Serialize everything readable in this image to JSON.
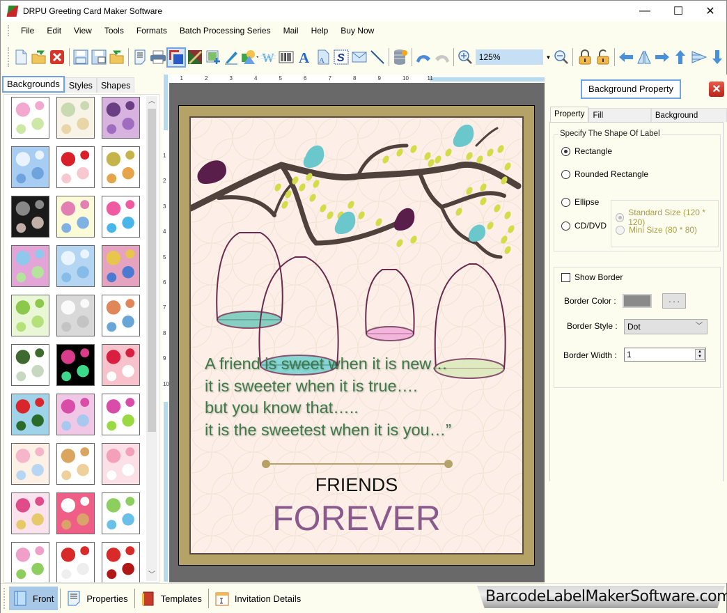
{
  "window": {
    "title": "DRPU Greeting Card Maker Software",
    "controls": {
      "minimize": "—",
      "maximize": "☐",
      "close": "✕"
    }
  },
  "menu": [
    "File",
    "Edit",
    "View",
    "Tools",
    "Formats",
    "Batch Processing Series",
    "Mail",
    "Help",
    "Buy Now"
  ],
  "toolbar": {
    "icons": [
      "new-icon",
      "open-icon",
      "close-file-icon",
      "save-icon",
      "save-as-icon",
      "export-icon",
      "properties-icon",
      "print-icon",
      "background-icon",
      "image-icon",
      "insert-picture-icon",
      "pencil-icon",
      "shapes-icon",
      "watermark-icon",
      "barcode-icon",
      "text-icon",
      "word-art-icon",
      "signature-icon",
      "mail-icon",
      "line-icon",
      "database-icon",
      "undo-icon",
      "redo-icon",
      "zoom-in-icon",
      "zoom-out-icon",
      "lock-icon",
      "unlock-icon",
      "arrow-left-icon",
      "flip-icon",
      "arrow-right-icon",
      "arrow-up-icon",
      "align-icon",
      "arrow-down-icon"
    ],
    "zoom_value": "125%"
  },
  "left_panel": {
    "tabs": [
      "Backgrounds",
      "Styles",
      "Shapes"
    ],
    "active_tab": "Backgrounds",
    "thumbnails": [
      {
        "name": "baby-pink",
        "colors": [
          "#fff",
          "#f3a8cf",
          "#cde8a6"
        ]
      },
      {
        "name": "baby-cream",
        "colors": [
          "#f7f3e6",
          "#c9d9b2",
          "#e8d5a8"
        ]
      },
      {
        "name": "purple-flowers",
        "colors": [
          "#d9b3e0",
          "#6b3d82",
          "#a06cc0"
        ]
      },
      {
        "name": "clouds",
        "colors": [
          "#a7cdf2",
          "#e8f3ff",
          "#6fa3de"
        ]
      },
      {
        "name": "strawberries",
        "colors": [
          "#fff",
          "#d91f2a",
          "#f7c8cf"
        ]
      },
      {
        "name": "leaves",
        "colors": [
          "#fff",
          "#c6b34a",
          "#e5a34a"
        ]
      },
      {
        "name": "dark-roses",
        "colors": [
          "#1a1a1a",
          "#888",
          "#c0b0a8"
        ]
      },
      {
        "name": "flower-rows",
        "colors": [
          "#fcfbd8",
          "#e37fb3",
          "#7fb1e3"
        ]
      },
      {
        "name": "gifts",
        "colors": [
          "#fff",
          "#f05aa0",
          "#4ab5e8"
        ]
      },
      {
        "name": "pastel-flowers",
        "colors": [
          "#e3a5d8",
          "#8ec8ec",
          "#b5e39d"
        ]
      },
      {
        "name": "snowflakes",
        "colors": [
          "#b4d6f2",
          "#e9f4ff",
          "#86bde8"
        ]
      },
      {
        "name": "mandalas",
        "colors": [
          "#e5a3c0",
          "#e8c64d",
          "#4c7ad0"
        ]
      },
      {
        "name": "trees",
        "colors": [
          "#e9f7d6",
          "#8cc84b",
          "#b6e07a"
        ]
      },
      {
        "name": "white-heart",
        "colors": [
          "#d9d9d9",
          "#fafafa",
          "#c4c4c4"
        ]
      },
      {
        "name": "kids",
        "colors": [
          "#fff",
          "#e0875a",
          "#6aa5d8"
        ]
      },
      {
        "name": "mistletoe",
        "colors": [
          "#fff",
          "#3f6a2f",
          "#c8d8c0"
        ]
      },
      {
        "name": "fireworks",
        "colors": [
          "#000",
          "#d93c8a",
          "#3cd98a"
        ]
      },
      {
        "name": "red-hearts",
        "colors": [
          "#f7c2cc",
          "#d91f40",
          "#fff"
        ]
      },
      {
        "name": "christmas",
        "colors": [
          "#9fd3ea",
          "#d9262c",
          "#2a6a2a"
        ]
      },
      {
        "name": "pink-bokeh",
        "colors": [
          "#f0c8e6",
          "#d94ca8",
          "#a9c8ef"
        ]
      },
      {
        "name": "lilies",
        "colors": [
          "#fff",
          "#d94ca8",
          "#9ad941"
        ]
      },
      {
        "name": "stripes",
        "colors": [
          "#fdf1e6",
          "#f4b6c8",
          "#b6d6f4"
        ]
      },
      {
        "name": "teddy",
        "colors": [
          "#fff",
          "#d9a55f",
          "#f0d09a"
        ]
      },
      {
        "name": "dresses",
        "colors": [
          "#fbe0e8",
          "#f4a0b8",
          "#fff"
        ]
      },
      {
        "name": "heart-collage",
        "colors": [
          "#fbe3ee",
          "#e04c8a",
          "#e6c96b"
        ]
      },
      {
        "name": "heart-frame",
        "colors": [
          "#ef5e87",
          "#fff",
          "#d9a36a"
        ]
      },
      {
        "name": "bunnies",
        "colors": [
          "#fff",
          "#8ccf5e",
          "#6ac0e8"
        ]
      },
      {
        "name": "kids-2",
        "colors": [
          "#fff",
          "#f0a0c8",
          "#8ccf5e"
        ]
      },
      {
        "name": "white-hearts-bows",
        "colors": [
          "#fff",
          "#d92a2a",
          "#eee"
        ]
      },
      {
        "name": "red-flower",
        "colors": [
          "#fff",
          "#d92a2a",
          "#b01818"
        ]
      }
    ]
  },
  "rulers": {
    "horizontal": [
      "1",
      "2",
      "3",
      "4",
      "5",
      "6",
      "7",
      "8",
      "9",
      "10",
      "11"
    ],
    "vertical": [
      "1",
      "2",
      "3",
      "4",
      "5",
      "6",
      "7",
      "8",
      "9",
      "10"
    ]
  },
  "card": {
    "quote_lines": [
      "A friend is sweet when it is new…",
      "it is sweeter when it is true….",
      "but you know that…..",
      "it is the sweetest when it is you…”"
    ],
    "title_small": "FRIENDS",
    "title_large": "FOREVER",
    "colors": {
      "frame": "#b5a267",
      "paper": "#fdefe8",
      "quote": "#3d7a48",
      "forever": "#8a5a8c"
    }
  },
  "right_panel": {
    "title": "Background Property",
    "tabs": [
      "Property",
      "Fill Background",
      "Background Effects"
    ],
    "active_tab": "Property",
    "shape_group_label": "Specify The Shape Of Label",
    "shapes": [
      {
        "label": "Rectangle",
        "checked": true
      },
      {
        "label": "Rounded Rectangle",
        "checked": false
      },
      {
        "label": "Ellipse",
        "checked": false
      },
      {
        "label": "CD/DVD",
        "checked": false
      }
    ],
    "cd_sizes": [
      {
        "label": "Standard Size (120 * 120)",
        "checked": true,
        "disabled": true
      },
      {
        "label": "Mini Size (80 * 80)",
        "checked": false,
        "disabled": true
      }
    ],
    "show_border_label": "Show Border",
    "show_border": false,
    "border_color_label": "Border Color :",
    "border_color": "#8a8a8a",
    "browse_label": ". . .",
    "border_style_label": "Border Style :",
    "border_style": "Dot",
    "border_width_label": "Border Width :",
    "border_width": "1"
  },
  "bottom_tabs": [
    {
      "label": "Front",
      "icon": "front-page-icon",
      "active": true
    },
    {
      "label": "Properties",
      "icon": "properties-icon",
      "active": false
    },
    {
      "label": "Templates",
      "icon": "templates-icon",
      "active": false
    },
    {
      "label": "Invitation Details",
      "icon": "invitation-details-icon",
      "active": false
    }
  ],
  "brand": "BarcodeLabelMakerSoftware.com"
}
